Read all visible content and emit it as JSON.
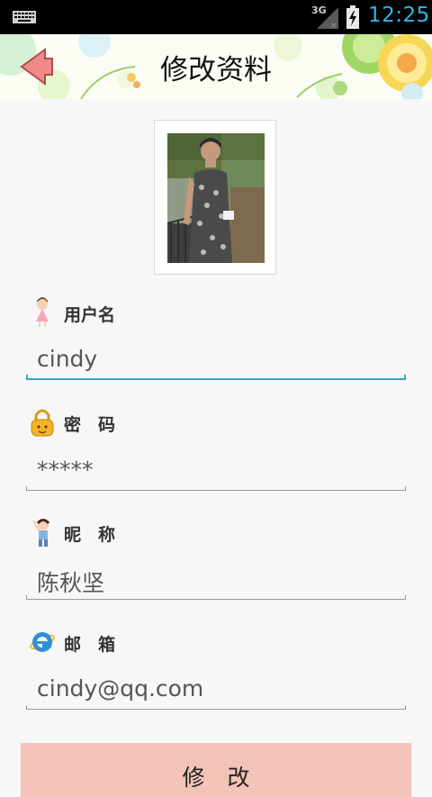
{
  "status_bar": {
    "network": "3G",
    "time": "12:25",
    "icons": [
      "keyboard-icon",
      "signal-icon",
      "battery-charging-icon"
    ],
    "accent_color": "#33b5e5"
  },
  "header": {
    "title": "修改资料",
    "back_icon": "back-arrow-icon"
  },
  "profile": {
    "avatar": "avatar-photo"
  },
  "form": {
    "username": {
      "label": "用户名",
      "value": "cindy",
      "icon": "girl-icon"
    },
    "password": {
      "label": "密　码",
      "value": "*****",
      "icon": "lock-icon"
    },
    "nickname": {
      "label": "昵　称",
      "value": "陈秋坚",
      "icon": "waving-child-icon"
    },
    "email": {
      "label": "邮　箱",
      "value": "cindy@qq.com",
      "icon": "ie-icon"
    },
    "focus_color": "#33a7d2"
  },
  "actions": {
    "submit_label": "修　改",
    "submit_color": "#f3c3b8"
  }
}
